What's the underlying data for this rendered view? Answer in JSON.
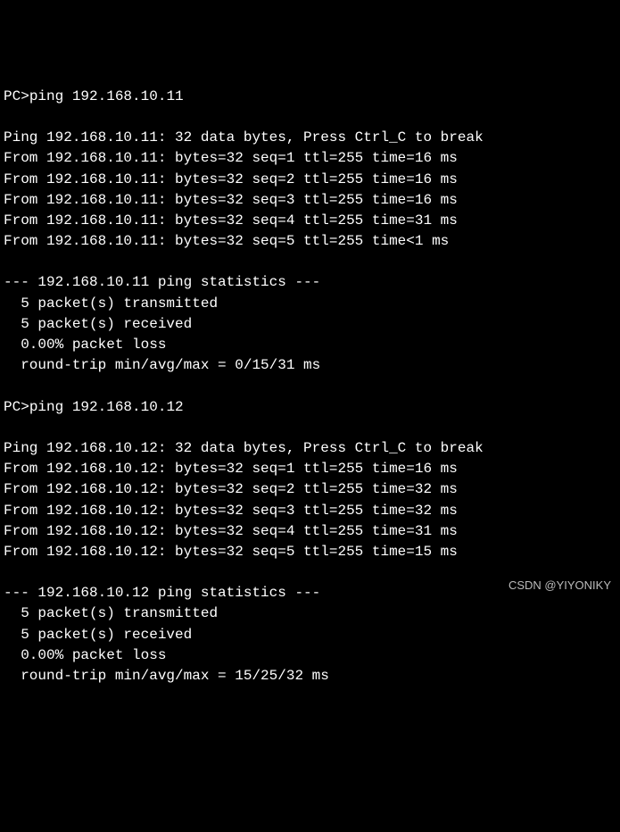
{
  "session1": {
    "prompt": "PC>",
    "command": "ping 192.168.10.11",
    "header": "Ping 192.168.10.11: 32 data bytes, Press Ctrl_C to break",
    "replies": [
      "From 192.168.10.11: bytes=32 seq=1 ttl=255 time=16 ms",
      "From 192.168.10.11: bytes=32 seq=2 ttl=255 time=16 ms",
      "From 192.168.10.11: bytes=32 seq=3 ttl=255 time=16 ms",
      "From 192.168.10.11: bytes=32 seq=4 ttl=255 time=31 ms",
      "From 192.168.10.11: bytes=32 seq=5 ttl=255 time<1 ms"
    ],
    "stats_header": "--- 192.168.10.11 ping statistics ---",
    "stats": [
      "  5 packet(s) transmitted",
      "  5 packet(s) received",
      "  0.00% packet loss",
      "  round-trip min/avg/max = 0/15/31 ms"
    ]
  },
  "session2": {
    "prompt": "PC>",
    "command": "ping 192.168.10.12",
    "header": "Ping 192.168.10.12: 32 data bytes, Press Ctrl_C to break",
    "replies": [
      "From 192.168.10.12: bytes=32 seq=1 ttl=255 time=16 ms",
      "From 192.168.10.12: bytes=32 seq=2 ttl=255 time=32 ms",
      "From 192.168.10.12: bytes=32 seq=3 ttl=255 time=32 ms",
      "From 192.168.10.12: bytes=32 seq=4 ttl=255 time=31 ms",
      "From 192.168.10.12: bytes=32 seq=5 ttl=255 time=15 ms"
    ],
    "stats_header": "--- 192.168.10.12 ping statistics ---",
    "stats": [
      "  5 packet(s) transmitted",
      "  5 packet(s) received",
      "  0.00% packet loss",
      "  round-trip min/avg/max = 15/25/32 ms"
    ]
  },
  "watermark": "CSDN @YIYONIKY"
}
